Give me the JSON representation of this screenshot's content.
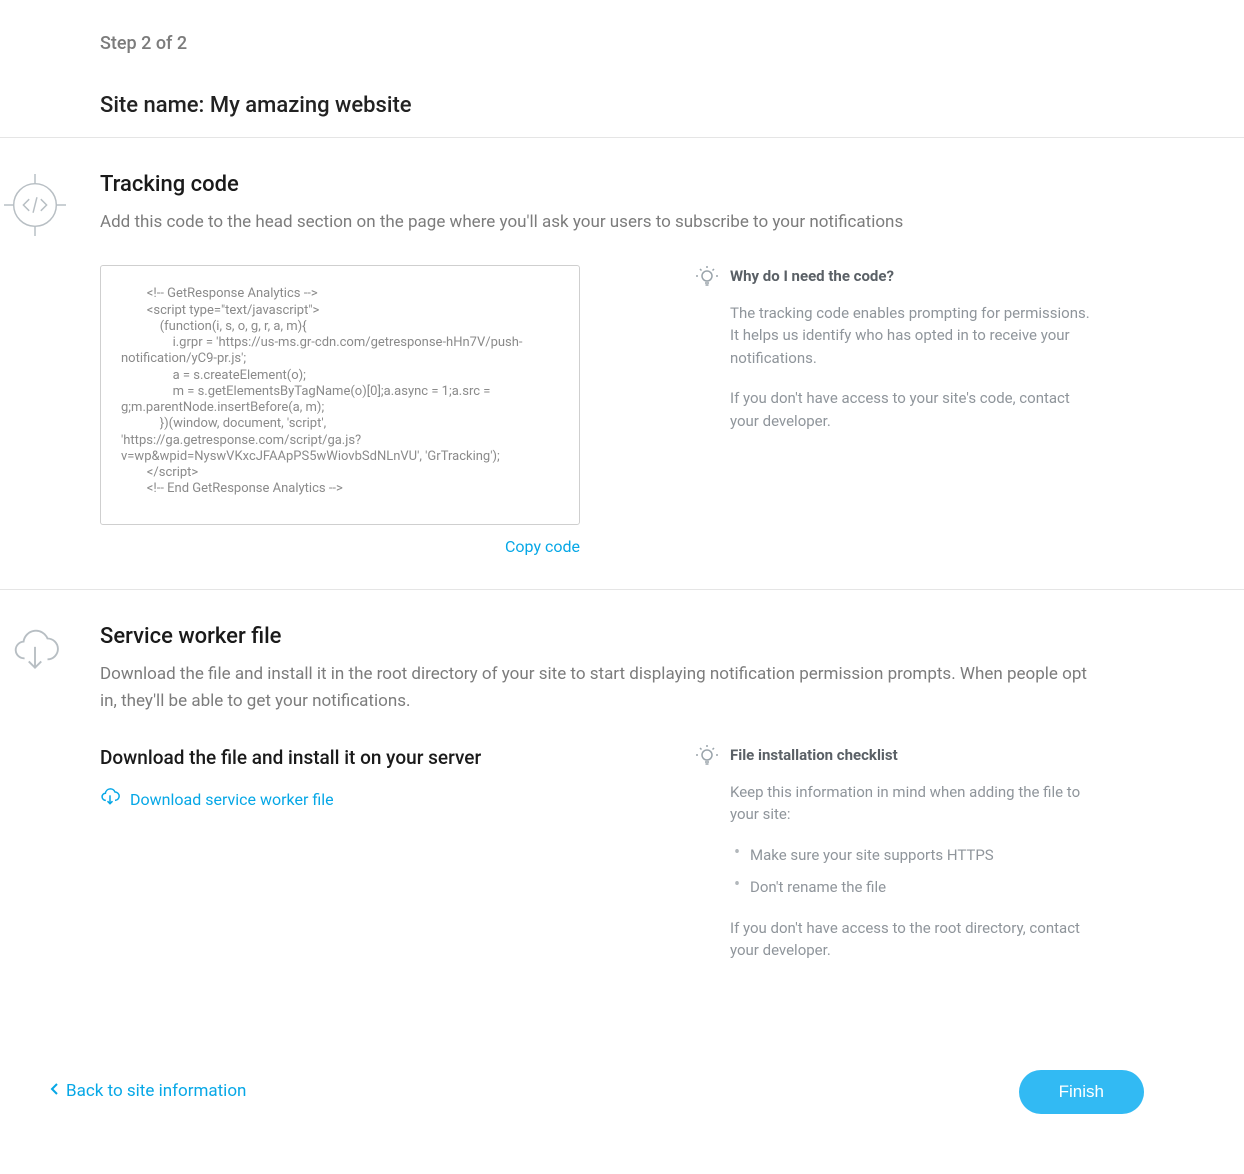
{
  "header": {
    "step_label": "Step 2 of 2",
    "site_name_label": "Site name: My amazing website"
  },
  "tracking": {
    "title": "Tracking code",
    "description": "Add this code to the head section on the page where you'll ask your users to subscribe to your notifications",
    "code": "        <!-- GetResponse Analytics -->\n        <script type=\"text/javascript\">\n            (function(i, s, o, g, r, a, m){\n                i.grpr = 'https://us-ms.gr-cdn.com/getresponse-hHn7V/push-notification/yC9-pr.js';\n                a = s.createElement(o);\n                m = s.getElementsByTagName(o)[0];a.async = 1;a.src = g;m.parentNode.insertBefore(a, m);\n            })(window, document, 'script', 'https://ga.getresponse.com/script/ga.js?v=wp&wpid=NyswVKxcJFAApPS5wWiovbSdNLnVU', 'GrTracking');\n        </script>\n        <!-- End GetResponse Analytics -->",
    "copy_link": "Copy code",
    "tip_title": "Why do I need the code?",
    "tip_text_1": "The tracking code enables prompting for permissions. It helps us identify who has opted in to receive your notifications.",
    "tip_text_2": "If you don't have access to your site's code, contact your developer."
  },
  "service_worker": {
    "title": "Service worker file",
    "description": "Download the file and install it in the root directory of your site to start displaying notification permission prompts. When people opt in, they'll be able to get your notifications.",
    "download_heading": "Download the file and install it on your server",
    "download_link": "Download service worker file",
    "tip_title": "File installation checklist",
    "tip_text_intro": "Keep this information in mind when adding the file to your site:",
    "tip_list": [
      "Make sure your site supports HTTPS",
      "Don't rename the file"
    ],
    "tip_text_outro": "If you don't have access to the root directory, contact your developer."
  },
  "footer": {
    "back_label": "Back to site information",
    "finish_label": "Finish"
  }
}
